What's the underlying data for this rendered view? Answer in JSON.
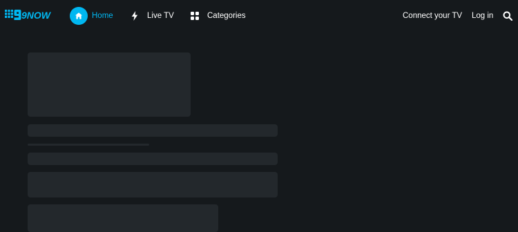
{
  "brand": {
    "logo_text": "9NOW",
    "accent_color": "#00b7f1"
  },
  "nav": {
    "items": [
      {
        "label": "Home",
        "icon": "home-icon",
        "active": true
      },
      {
        "label": "Live TV",
        "icon": "lightning-icon",
        "active": false
      },
      {
        "label": "Categories",
        "icon": "grid-icon",
        "active": false
      }
    ]
  },
  "header_right": {
    "connect_label": "Connect your TV",
    "login_label": "Log in",
    "search_icon": "search-icon"
  },
  "content": {
    "state": "loading",
    "placeholder_color": "#23282c",
    "background_color": "#15191c"
  }
}
